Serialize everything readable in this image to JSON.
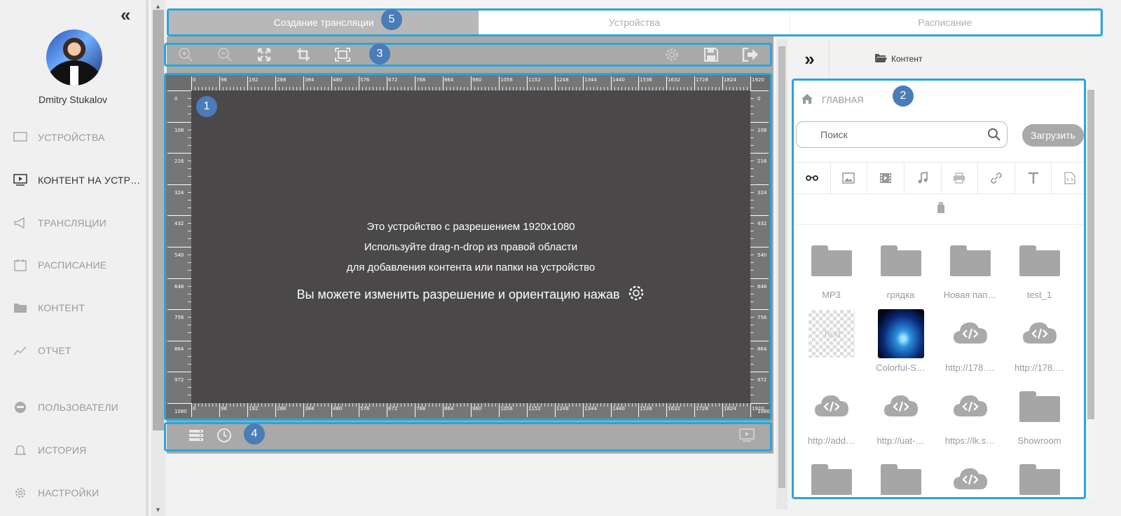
{
  "sidebar": {
    "collapse_label": "«",
    "username": "Dmitry Stukalov",
    "items": [
      {
        "label": "УСТРОЙСТВА",
        "icon": "monitor-icon",
        "active": false
      },
      {
        "label": "КОНТЕНТ НА УСТР…",
        "icon": "play-screen-icon",
        "active": true
      },
      {
        "label": "ТРАНСЛЯЦИИ",
        "icon": "megaphone-icon",
        "active": false
      },
      {
        "label": "РАСПИСАНИЕ",
        "icon": "calendar-icon",
        "active": false
      },
      {
        "label": "КОНТЕНТ",
        "icon": "folder-icon",
        "active": false
      },
      {
        "label": "ОТЧЕТ",
        "icon": "chart-line-icon",
        "active": false
      },
      {
        "label": "ПОЛЬЗОВАТЕЛИ",
        "icon": "users-icon",
        "active": false
      },
      {
        "label": "ИСТОРИЯ",
        "icon": "bell-icon",
        "active": false
      },
      {
        "label": "НАСТРОЙКИ",
        "icon": "gear-icon",
        "active": false
      }
    ]
  },
  "tabs": [
    {
      "label": "Создание трансляции",
      "active": true
    },
    {
      "label": "Устройства",
      "active": false
    },
    {
      "label": "Расписание",
      "active": false
    }
  ],
  "toolbar": {
    "left_icons": [
      "zoom-in-icon",
      "zoom-out-icon",
      "fit-screen-icon",
      "crop-icon",
      "frame-icon"
    ],
    "right_icons": [
      "gear-icon",
      "save-icon",
      "exit-icon"
    ]
  },
  "ruler": {
    "h_ticks": [
      "0",
      "96",
      "192",
      "288",
      "384",
      "480",
      "576",
      "672",
      "768",
      "864",
      "960",
      "1056",
      "1152",
      "1248",
      "1344",
      "1440",
      "1536",
      "1632",
      "1728",
      "1824",
      "1920"
    ],
    "v_ticks": [
      "0",
      "108",
      "216",
      "324",
      "432",
      "540",
      "648",
      "756",
      "864",
      "972",
      "1080"
    ]
  },
  "canvas": {
    "line1": "Это устройство с разрешением 1920x1080",
    "line2": "Используйте drag-n-drop из правой области",
    "line3": "для добавления контента или папки на устройство",
    "line4": "Вы можете изменить разрешение и ориентацию нажав"
  },
  "bottombar": {
    "icons": [
      "layers-icon",
      "clock-icon",
      "preview-icon"
    ]
  },
  "right_panel": {
    "expand_label": "»",
    "header_label": "Контент",
    "breadcrumb": "ГЛАВНАЯ",
    "search_placeholder": "Поиск",
    "upload_label": "Загрузить",
    "filters": [
      "glasses-icon",
      "image-icon",
      "video-icon",
      "music-icon",
      "print-icon",
      "link-icon",
      "text-icon",
      "code-file-icon"
    ],
    "items": [
      {
        "type": "folder",
        "caption": "MP3"
      },
      {
        "type": "folder",
        "caption": "грядка"
      },
      {
        "type": "folder",
        "caption": "Новая пап…"
      },
      {
        "type": "folder",
        "caption": "test_1"
      },
      {
        "type": "text",
        "caption": "",
        "thumb_text": "Text"
      },
      {
        "type": "image",
        "caption": "Colorful-S…"
      },
      {
        "type": "web",
        "caption": "http://178.…"
      },
      {
        "type": "web",
        "caption": "http://178.…"
      },
      {
        "type": "web",
        "caption": "http://add…"
      },
      {
        "type": "web",
        "caption": "http://uat-…"
      },
      {
        "type": "web",
        "caption": "https://lk.s…"
      },
      {
        "type": "folder",
        "caption": "Showroom"
      },
      {
        "type": "folder",
        "caption": ""
      },
      {
        "type": "folder",
        "caption": ""
      },
      {
        "type": "web",
        "caption": ""
      },
      {
        "type": "folder",
        "caption": ""
      }
    ]
  },
  "badges": [
    "1",
    "2",
    "3",
    "4",
    "5"
  ],
  "colors": {
    "accent": "#29a6d9",
    "badge": "#4a7cb8",
    "stage": "#4a4849"
  }
}
